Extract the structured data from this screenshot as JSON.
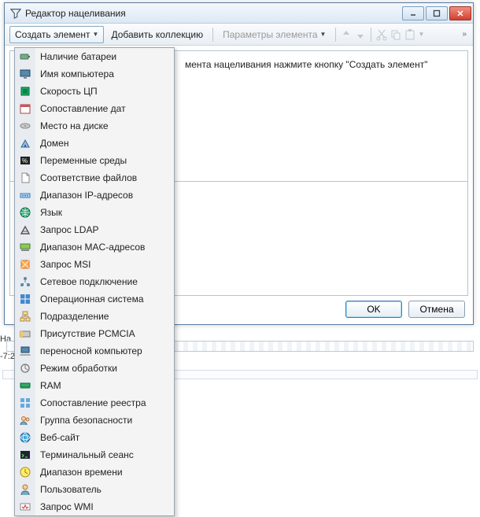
{
  "window": {
    "title": "Редактор нацеливания"
  },
  "toolbar": {
    "create_label": "Создать элемент",
    "add_collection_label": "Добавить коллекцию",
    "params_label": "Параметры элемента",
    "chevrons": "»"
  },
  "content": {
    "hint_suffix": "мента нацеливания нажмите кнопку \"Создать элемент\""
  },
  "buttons": {
    "ok": "OK",
    "cancel": "Отмена"
  },
  "left_labels": {
    "ha": "На",
    "time": "-7:2"
  },
  "menu": {
    "items": [
      {
        "label": "Наличие батареи",
        "name": "battery-exists-item",
        "icon": "battery"
      },
      {
        "label": "Имя компьютера",
        "name": "computer-name-item",
        "icon": "monitor"
      },
      {
        "label": "Скорость ЦП",
        "name": "cpu-speed-item",
        "icon": "cpu"
      },
      {
        "label": "Сопоставление дат",
        "name": "date-match-item",
        "icon": "calendar"
      },
      {
        "label": "Место на диске",
        "name": "disk-space-item",
        "icon": "disk"
      },
      {
        "label": "Домен",
        "name": "domain-item",
        "icon": "domain"
      },
      {
        "label": "Переменные среды",
        "name": "env-vars-item",
        "icon": "env"
      },
      {
        "label": "Соответствие файлов",
        "name": "file-match-item",
        "icon": "file"
      },
      {
        "label": "Диапазон IP-адресов",
        "name": "ip-range-item",
        "icon": "ip"
      },
      {
        "label": "Язык",
        "name": "language-item",
        "icon": "globe"
      },
      {
        "label": "Запрос LDAP",
        "name": "ldap-query-item",
        "icon": "ldap"
      },
      {
        "label": "Диапазон MAC-адресов",
        "name": "mac-range-item",
        "icon": "mac"
      },
      {
        "label": "Запрос MSI",
        "name": "msi-query-item",
        "icon": "msi"
      },
      {
        "label": "Сетевое подключение",
        "name": "network-conn-item",
        "icon": "network"
      },
      {
        "label": "Операционная система",
        "name": "os-item",
        "icon": "os"
      },
      {
        "label": "Подразделение",
        "name": "org-unit-item",
        "icon": "ou"
      },
      {
        "label": "Присутствие PCMCIA",
        "name": "pcmcia-item",
        "icon": "pcmcia"
      },
      {
        "label": "переносной компьютер",
        "name": "portable-item",
        "icon": "laptop"
      },
      {
        "label": "Режим обработки",
        "name": "processing-mode-item",
        "icon": "mode"
      },
      {
        "label": "RAM",
        "name": "ram-item",
        "icon": "ram"
      },
      {
        "label": "Сопоставление реестра",
        "name": "registry-match-item",
        "icon": "registry"
      },
      {
        "label": "Группа безопасности",
        "name": "security-group-item",
        "icon": "group"
      },
      {
        "label": "Веб-сайт",
        "name": "website-item",
        "icon": "web"
      },
      {
        "label": "Терминальный сеанс",
        "name": "terminal-session-item",
        "icon": "terminal"
      },
      {
        "label": "Диапазон времени",
        "name": "time-range-item",
        "icon": "clock"
      },
      {
        "label": "Пользователь",
        "name": "user-item",
        "icon": "user"
      },
      {
        "label": "Запрос WMI",
        "name": "wmi-query-item",
        "icon": "wmi"
      }
    ]
  }
}
